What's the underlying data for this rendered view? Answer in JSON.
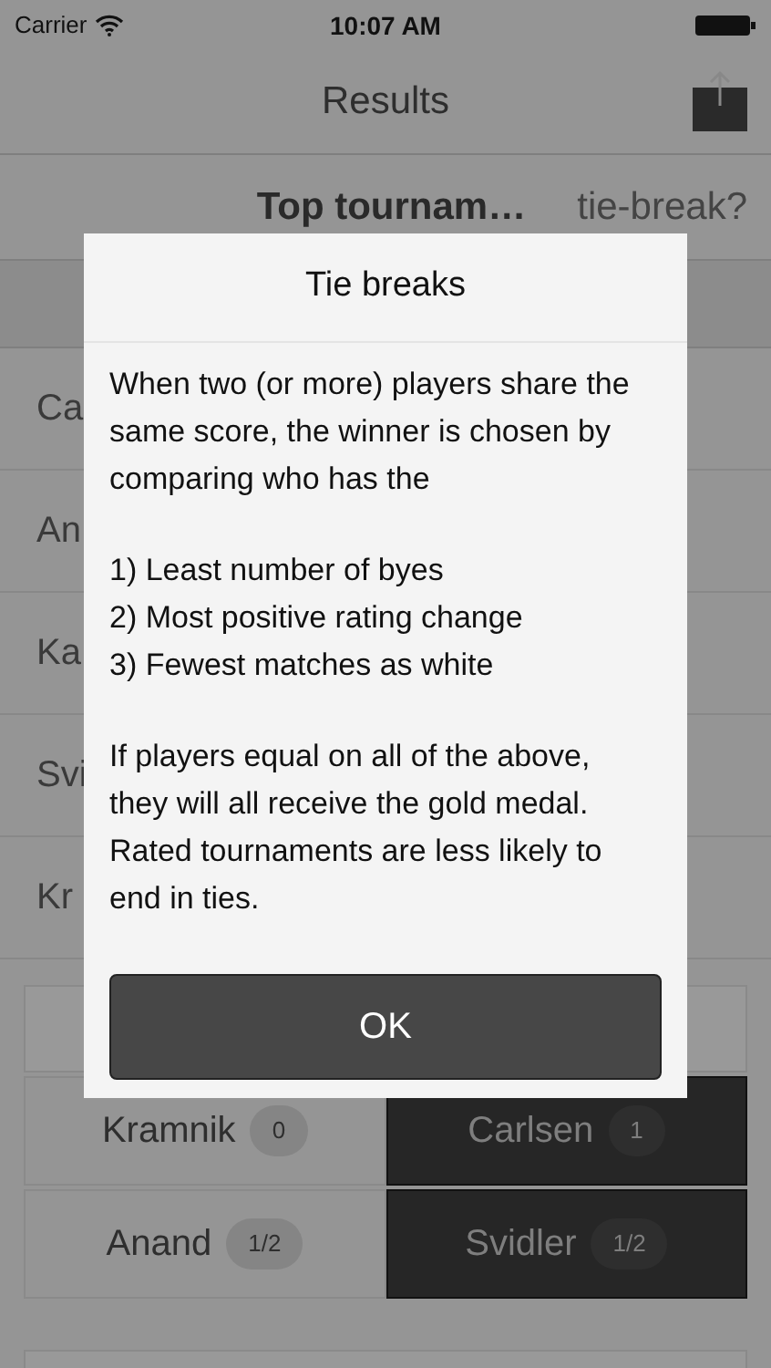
{
  "status_bar": {
    "carrier": "Carrier",
    "time": "10:07 AM"
  },
  "nav_bar": {
    "title": "Results"
  },
  "subheader": {
    "tournament": "Top tournam…",
    "link": "tie-break?"
  },
  "standings": [
    {
      "name": "Ca"
    },
    {
      "name": "An"
    },
    {
      "name": "Ka"
    },
    {
      "name": "Svi"
    },
    {
      "name": "Kr"
    }
  ],
  "pairings": [
    {
      "white": {
        "name": "Kramnik",
        "score": "0"
      },
      "black": {
        "name": "Carlsen",
        "score": "1"
      }
    },
    {
      "white": {
        "name": "Anand",
        "score": "1/2"
      },
      "black": {
        "name": "Svidler",
        "score": "1/2"
      }
    }
  ],
  "dialog": {
    "title": "Tie breaks",
    "paragraphs": [
      [
        "When two (or more) players share the same score, the winner is chosen by comparing who has the"
      ],
      [
        "1) Least number of byes",
        "2) Most positive rating change",
        "3) Fewest matches as white"
      ],
      [
        "If players equal on all of the above, they will all receive the gold medal. Rated tournaments are less likely to end in ties."
      ]
    ],
    "button": "OK"
  }
}
